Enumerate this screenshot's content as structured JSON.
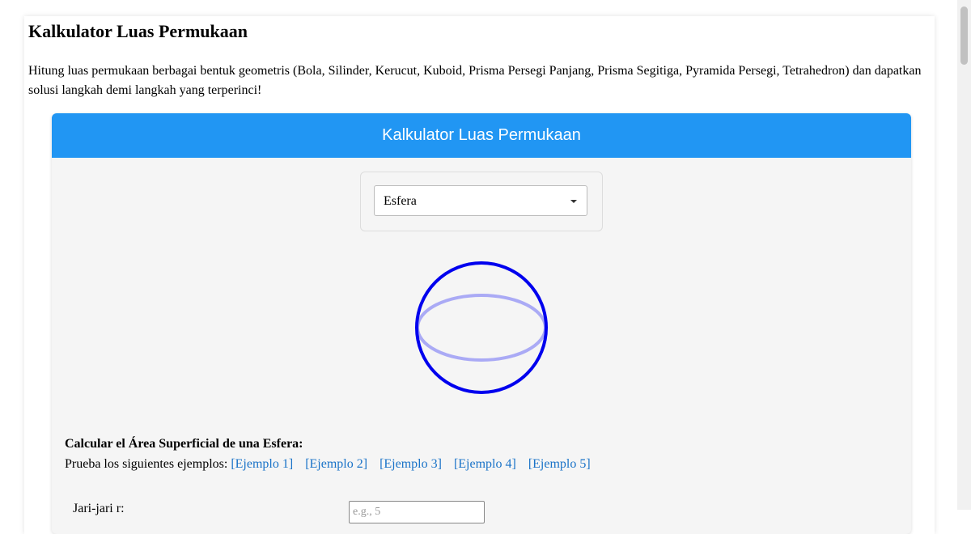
{
  "page": {
    "title": "Kalkulator Luas Permukaan",
    "description": "Hitung luas permukaan berbagai bentuk geometris (Bola, Silinder, Kerucut, Kuboid, Prisma Persegi Panjang, Prisma Segitiga, Pyramida Persegi, Tetrahedron) dan dapatkan solusi langkah demi langkah yang terperinci!"
  },
  "calculator": {
    "header": "Kalkulator Luas Permukaan",
    "shape_select": {
      "selected": "Esfera"
    },
    "figure": {
      "icon": "sphere-icon",
      "outline_color": "#0000ee",
      "equator_color": "#aaaaf5"
    },
    "section_heading": "Calcular el Área Superficial de una Esfera:",
    "examples_prompt": "Prueba los siguientes ejemplos:",
    "examples": [
      "[Ejemplo 1]",
      "[Ejemplo 2]",
      "[Ejemplo 3]",
      "[Ejemplo 4]",
      "[Ejemplo 5]"
    ],
    "radius_label": "Jari-jari r:",
    "radius_placeholder": "e.g., 5"
  },
  "colors": {
    "header_bg": "#2196f3",
    "link": "#1a73c8",
    "panel_bg": "#f5f5f5"
  }
}
